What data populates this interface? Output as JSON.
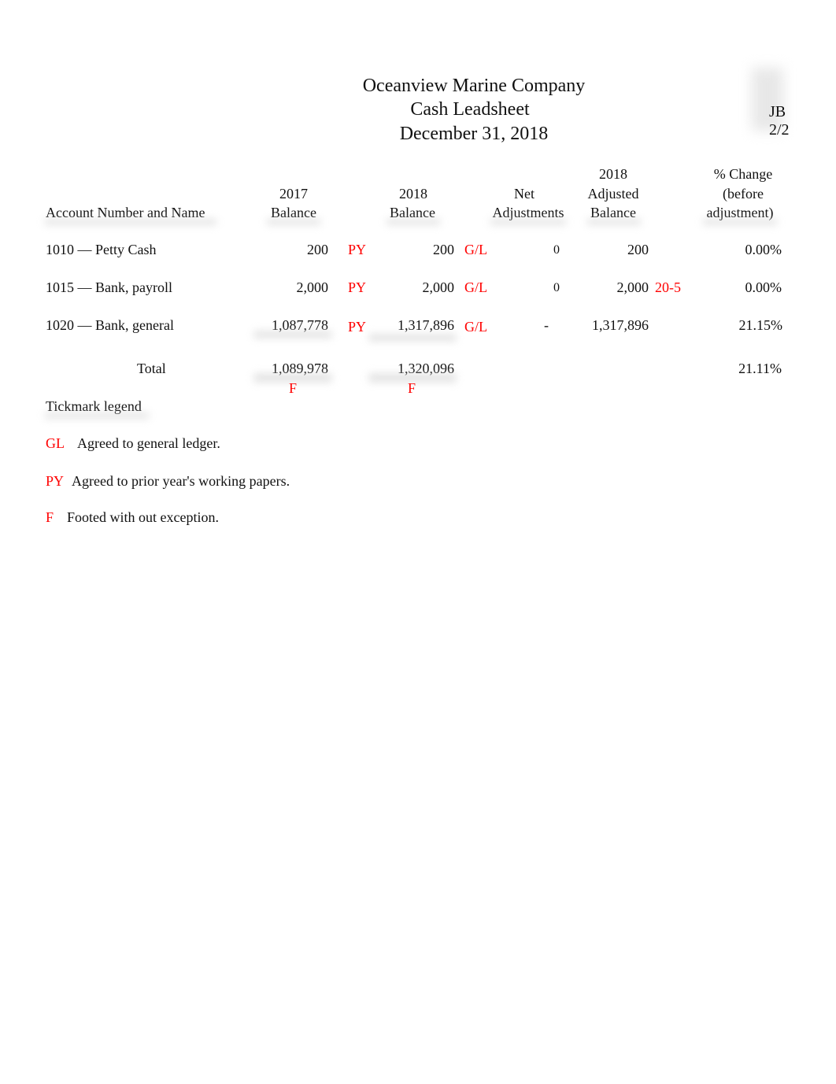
{
  "header": {
    "company": "Oceanview Marine Company",
    "title": "Cash Leadsheet",
    "date": "December 31, 2018",
    "preparer_initials": "JB",
    "preparer_date": "2/2"
  },
  "columns": {
    "account": "Account Number and Name",
    "bal2017_line1": "2017",
    "bal2017_line2": "Balance",
    "bal2018_line1": "2018",
    "bal2018_line2": "Balance",
    "net_line1": "Net",
    "net_line2": "Adjustments",
    "adj_line1": "2018",
    "adj_line2": "Adjusted",
    "adj_line3": "Balance",
    "pct_line1": "% Change",
    "pct_line2": "(before",
    "pct_line3": "adjustment)"
  },
  "rows": [
    {
      "account": "1010 — Petty Cash",
      "bal2017": "200",
      "tick2017": "PY",
      "bal2018": "200",
      "tick2018": "G/L",
      "net": "0",
      "adjusted": "200",
      "adj_ref": "",
      "pct": "0.00%"
    },
    {
      "account": "1015 — Bank, payroll",
      "bal2017": "2,000",
      "tick2017": "PY",
      "bal2018": "2,000",
      "tick2018": "G/L",
      "net": "0",
      "adjusted": "2,000",
      "adj_ref": "20-5",
      "pct": "0.00%"
    },
    {
      "account": "1020 — Bank, general",
      "bal2017": "1,087,778",
      "tick2017": "PY",
      "bal2018": "1,317,896",
      "tick2018": "G/L",
      "net": "-",
      "adjusted": "1,317,896",
      "adj_ref": "",
      "pct": "21.15%"
    }
  ],
  "total": {
    "label": "Total",
    "bal2017": "1,089,978",
    "tick2017": "F",
    "bal2018": "1,320,096",
    "tick2018": "F",
    "pct": "21.11%"
  },
  "legend": {
    "title": "Tickmark legend",
    "items": [
      {
        "mark": "GL",
        "text": "Agreed to general ledger."
      },
      {
        "mark": "PY",
        "text": "Agreed to prior year's working papers."
      },
      {
        "mark": "F",
        "text": "Footed with out exception."
      }
    ]
  },
  "colors": {
    "tickmark": "#ff0000",
    "text": "#111111"
  }
}
